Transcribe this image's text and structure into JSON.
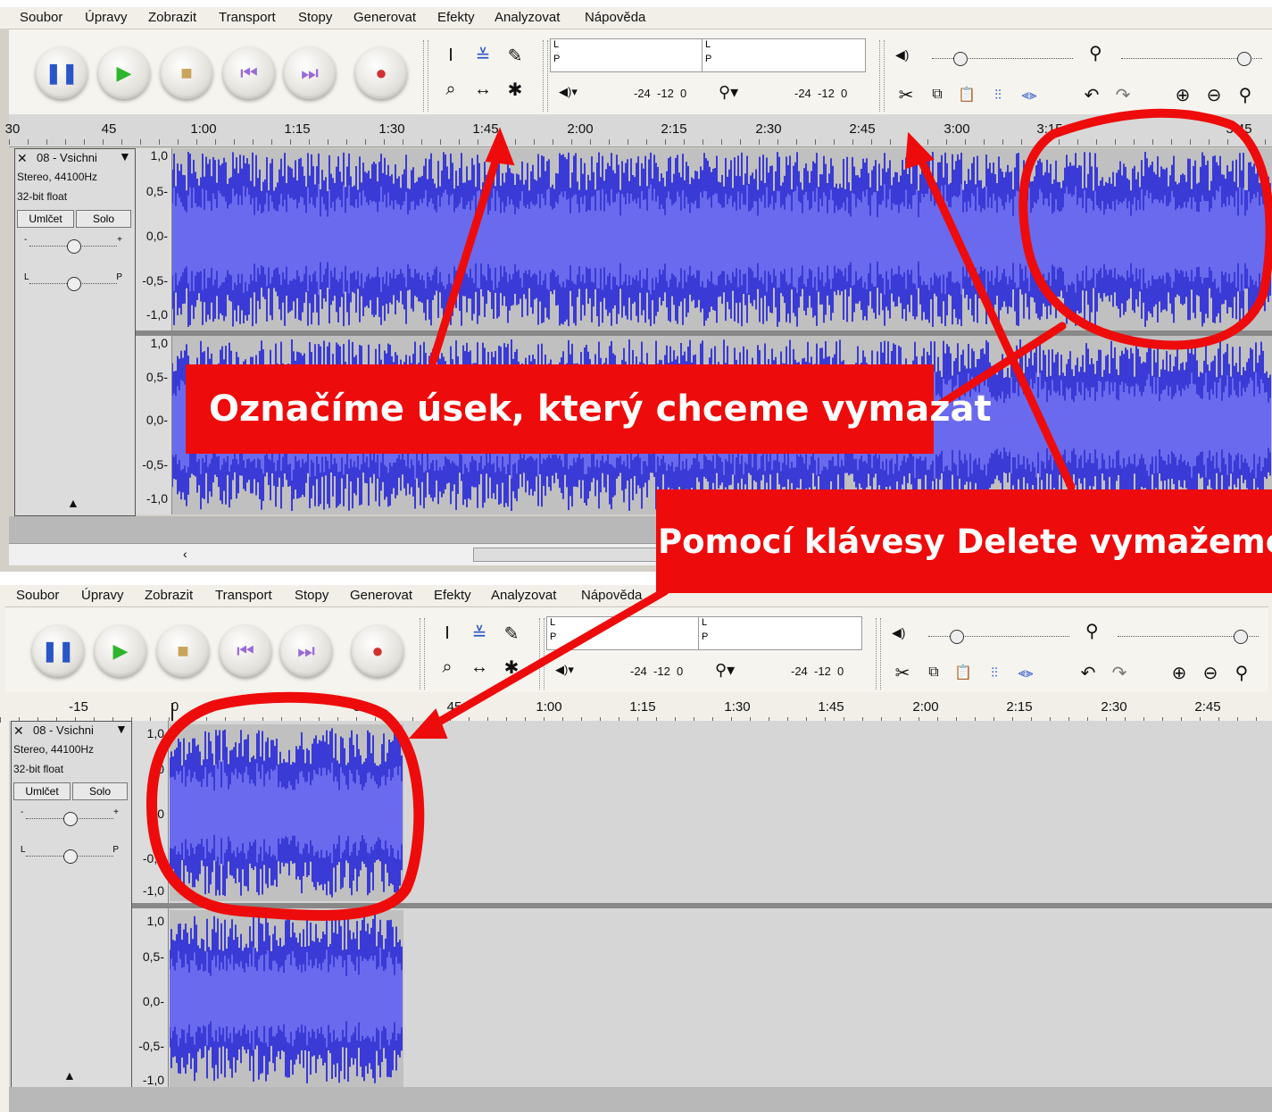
{
  "menu": [
    "Soubor",
    "Úpravy",
    "Zobrazit",
    "Transport",
    "Stopy",
    "Generovat",
    "Efekty",
    "Analyzovat",
    "Nápověda"
  ],
  "meters": {
    "left": "L",
    "right": "P",
    "scale_a": "-24  -12  0",
    "scale_b": "-24  -12  0",
    "speaker": "🔈",
    "mic": "🎤"
  },
  "ruler_top": [
    "30",
    "45",
    "1:00",
    "1:15",
    "1:30",
    "1:45",
    "2:00",
    "2:15",
    "2:30",
    "2:45",
    "3:00",
    "3:15",
    "3:45"
  ],
  "ruler_bottom": [
    "-15",
    "0",
    "30",
    "45",
    "1:00",
    "1:15",
    "1:30",
    "1:45",
    "2:00",
    "2:15",
    "2:30",
    "2:45"
  ],
  "track": {
    "name": "08 - Vsichni",
    "format": "Stereo, 44100Hz",
    "bits": "32-bit float",
    "mute": "Umlčet",
    "solo": "Solo",
    "gain_minus": "-",
    "gain_plus": "+",
    "pan_left": "L",
    "pan_right": "P"
  },
  "scale": [
    "1,0",
    "0,5-",
    "0,0-",
    "-0,5-",
    "-1,0"
  ],
  "scale_bottom_left_clip": [
    "1,0",
    "0",
    "0",
    "-0,5",
    "-1,0"
  ],
  "annotations": {
    "callout1": "Označíme úsek, který chceme vymazat",
    "callout2": "Pomocí klávesy Delete vymažeme"
  },
  "colors": {
    "wave": "#3a3ad6",
    "wave_light": "#6a6aee",
    "callout": "#ee0b0b",
    "bg": "#c0c0c0"
  }
}
